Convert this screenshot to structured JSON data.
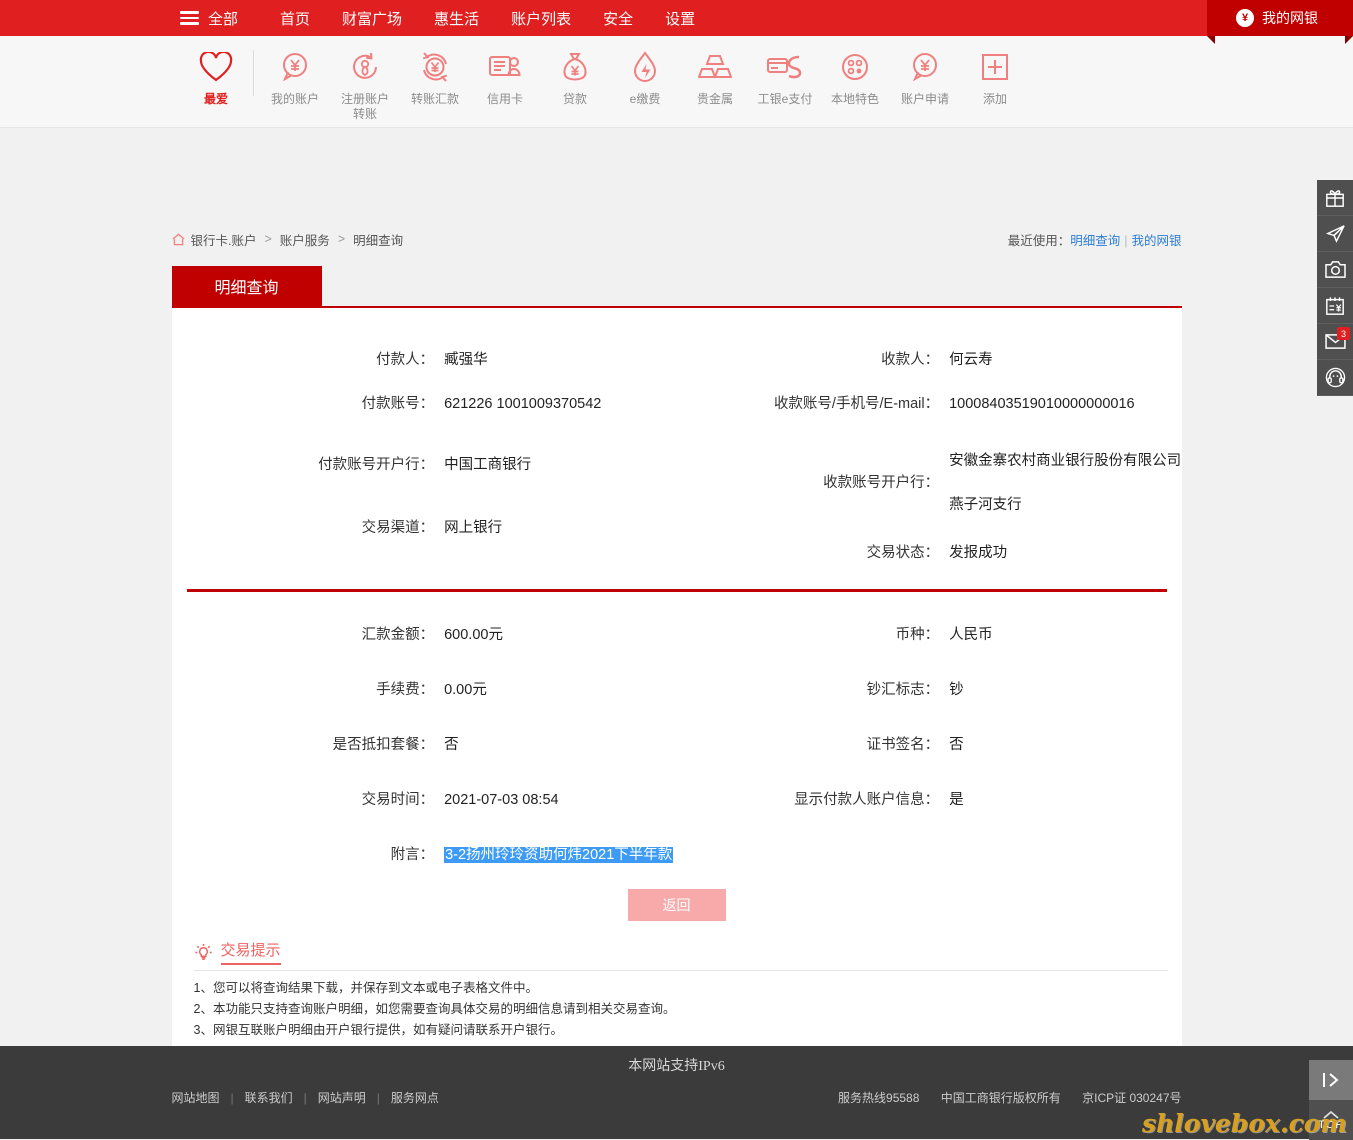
{
  "topnav": {
    "all_label": "全部",
    "items": [
      {
        "label": "首页"
      },
      {
        "label": "财富广场"
      },
      {
        "label": "惠生活"
      },
      {
        "label": "账户列表"
      },
      {
        "label": "安全"
      },
      {
        "label": "设置"
      }
    ],
    "mybank_label": "我的网银",
    "mybank_icon": "money-bag-icon",
    "menu_icon": "hamburger-icon",
    "bg_color": "#e02020",
    "tab_color": "#c00000"
  },
  "toolbar": {
    "items": [
      {
        "label": "最爱",
        "icon": "heart-icon"
      },
      {
        "label": "我的账户",
        "icon": "yuan-speech-bubble-icon"
      },
      {
        "label": "注册账户\n转账",
        "icon": "refresh-person-icon"
      },
      {
        "label": "转账汇款",
        "icon": "yuan-refresh-icon"
      },
      {
        "label": "信用卡",
        "icon": "credit-card-icon"
      },
      {
        "label": "贷款",
        "icon": "money-bag-icon"
      },
      {
        "label": "e缴费",
        "icon": "water-drop-bolt-icon"
      },
      {
        "label": "贵金属",
        "icon": "gold-bars-icon"
      },
      {
        "label": "工银e支付",
        "icon": "e-pay-card-icon"
      },
      {
        "label": "本地特色",
        "icon": "dots-circle-icon"
      },
      {
        "label": "账户申请",
        "icon": "yuan-speech-bubble-icon"
      },
      {
        "label": "添加",
        "icon": "plus-square-icon"
      }
    ]
  },
  "breadcrumb": {
    "home_icon": "home-icon",
    "parts": [
      "银行卡.账户",
      "账户服务",
      "明细查询"
    ],
    "separator": ">"
  },
  "recent": {
    "label": "最近使用：",
    "links": [
      "明细查询",
      "我的网银"
    ],
    "divider": "|"
  },
  "tab": {
    "active_label": "明细查询"
  },
  "detail": {
    "upper_left": [
      {
        "label": "付款人：",
        "value": "臧强华"
      },
      {
        "label": "付款账号：",
        "value": "621226 1001009370542"
      },
      {
        "label": "付款账号开户行：",
        "value": "中国工商银行"
      },
      {
        "label": "交易渠道：",
        "value": "网上银行"
      }
    ],
    "upper_right": [
      {
        "label": "收款人：",
        "value": "何云寿"
      },
      {
        "label": "收款账号/手机号/E-mail：",
        "value": "10008403519010000000016"
      },
      {
        "label": "收款账号开户行：",
        "value": "安徽金寨农村商业银行股份有限公司",
        "value2": "燕子河支行"
      },
      {
        "label": "交易状态：",
        "value": "发报成功"
      }
    ],
    "lower_left": [
      {
        "label": "汇款金额：",
        "value": "600.00元"
      },
      {
        "label": "手续费：",
        "value": "0.00元"
      },
      {
        "label": "是否抵扣套餐：",
        "value": "否"
      },
      {
        "label": "交易时间：",
        "value": "2021-07-03 08:54"
      },
      {
        "label": "附言：",
        "value": "3-2扬州玲玲资助何炜2021下半年款",
        "highlighted": true
      }
    ],
    "lower_right": [
      {
        "label": "币种：",
        "value": "人民币"
      },
      {
        "label": "钞汇标志：",
        "value": "钞"
      },
      {
        "label": "证书签名：",
        "value": "否"
      },
      {
        "label": "显示付款人账户信息：",
        "value": "是"
      }
    ]
  },
  "actions": {
    "back_label": "返回",
    "back_color": "#f8aaaa"
  },
  "tips": {
    "icon": "lightbulb-icon",
    "title": "交易提示",
    "items": [
      "1、您可以将查询结果下载，并保存到文本或电子表格文件中。",
      "2、本功能只支持查询账户明细，如您需要查询具体交易的明细信息请到相关交易查询。",
      "3、网银互联账户明细由开户银行提供，如有疑问请联系开户银行。"
    ]
  },
  "rail": {
    "items": [
      {
        "icon": "gift-icon",
        "badge": ""
      },
      {
        "icon": "paper-plane-icon",
        "badge": ""
      },
      {
        "icon": "camera-icon",
        "badge": ""
      },
      {
        "icon": "bill-calendar-icon",
        "badge": ""
      },
      {
        "icon": "mail-icon",
        "badge": "3"
      },
      {
        "icon": "headset-icon",
        "badge": ""
      }
    ],
    "collapse_icon": "expand-panel-icon",
    "top_label": "TOP",
    "top_icon": "chevron-up-icon"
  },
  "footer": {
    "ipv6": "本网站支持IPv6",
    "links": [
      "网站地图",
      "联系我们",
      "网站声明",
      "服务网点"
    ],
    "divider": "|",
    "hotline": "服务热线95588",
    "copyright": "中国工商银行版权所有",
    "icp": "京ICP证 030247号"
  },
  "watermark": "shlovebox.com"
}
